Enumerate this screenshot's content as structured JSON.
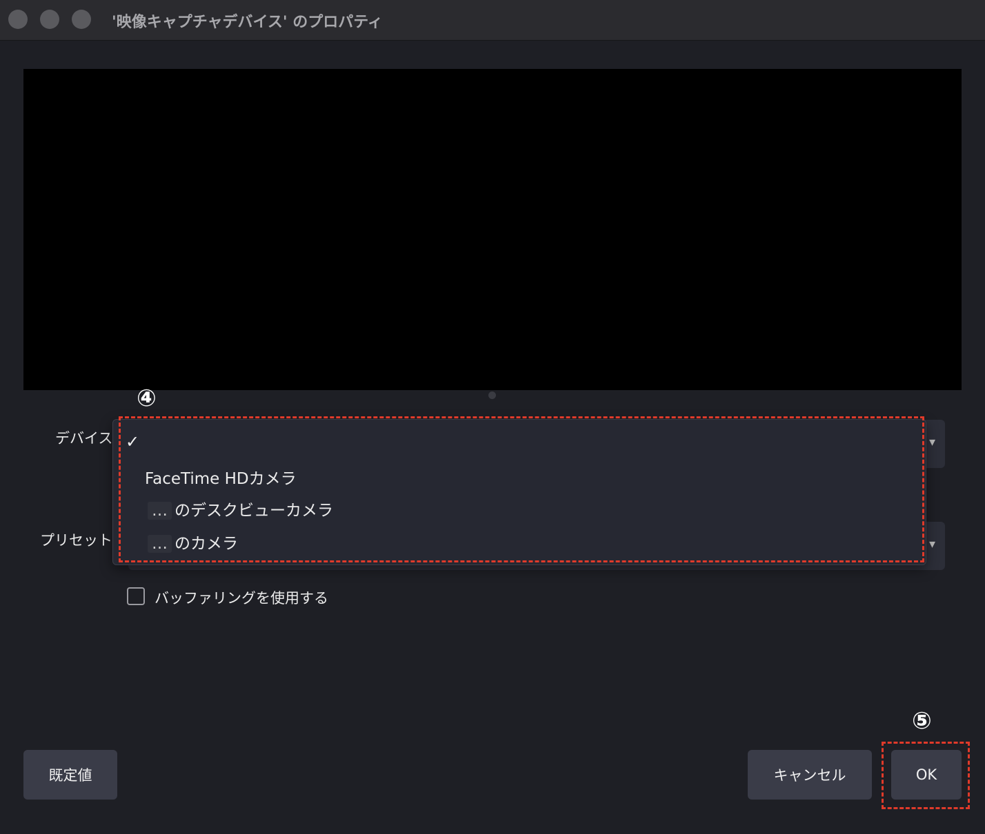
{
  "window": {
    "title": "'映像キャプチャデバイス' のプロパティ"
  },
  "form": {
    "device_label": "デバイス",
    "preset_label": "プリセット",
    "buffering_label": "バッファリングを使用する",
    "buffering_checked": false
  },
  "dropdown": {
    "checkmark": "✓",
    "options": [
      {
        "label": "FaceTime HDカメラ"
      },
      {
        "prefix": "…",
        "label": "のデスクビューカメラ"
      },
      {
        "prefix": "…",
        "label": "のカメラ"
      }
    ]
  },
  "annotations": {
    "step4": "④",
    "step5": "⑤",
    "highlight_color": "#e03a2a"
  },
  "buttons": {
    "defaults": "既定値",
    "cancel": "キャンセル",
    "ok": "OK"
  }
}
